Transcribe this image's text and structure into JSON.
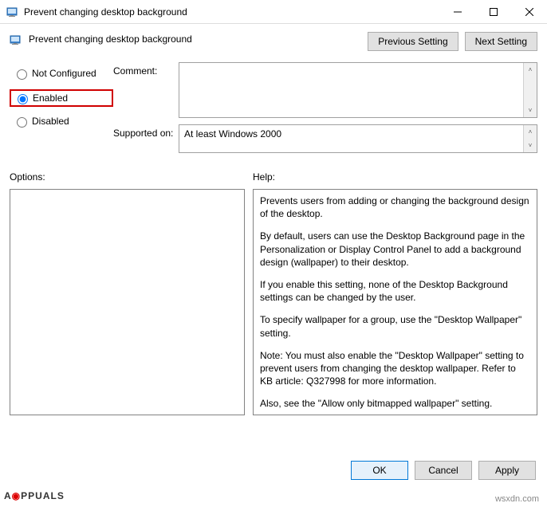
{
  "titlebar": {
    "title": "Prevent changing desktop background"
  },
  "header": {
    "policy_name": "Prevent changing desktop background",
    "prev_btn": "Previous Setting",
    "next_btn": "Next Setting"
  },
  "radios": {
    "not_configured": "Not Configured",
    "enabled": "Enabled",
    "disabled": "Disabled",
    "selected": "enabled"
  },
  "fields": {
    "comment_label": "Comment:",
    "comment_value": "",
    "supported_label": "Supported on:",
    "supported_value": "At least Windows 2000"
  },
  "panels": {
    "options_label": "Options:",
    "help_label": "Help:",
    "help_paragraphs": [
      "Prevents users from adding or changing the background design of the desktop.",
      "By default, users can use the Desktop Background page in the Personalization or Display Control Panel to add a background design (wallpaper) to their desktop.",
      "If you enable this setting, none of the Desktop Background settings can be changed by the user.",
      "To specify wallpaper for a group, use the \"Desktop Wallpaper\" setting.",
      "Note: You must also enable the \"Desktop Wallpaper\" setting to prevent users from changing the desktop wallpaper. Refer to KB article: Q327998 for more information.",
      "Also, see the \"Allow only bitmapped wallpaper\" setting."
    ]
  },
  "buttons": {
    "ok": "OK",
    "cancel": "Cancel",
    "apply": "Apply"
  },
  "watermark": {
    "text_a": "A",
    "text_b": "PPUALS",
    "site": "wsxdn.com"
  }
}
